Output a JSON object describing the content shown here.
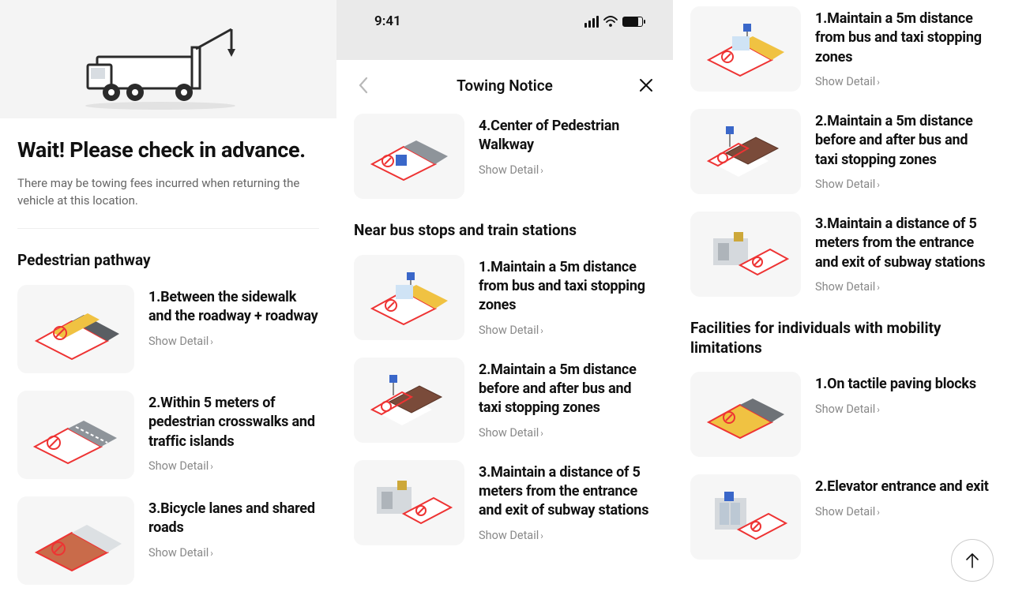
{
  "statusbar": {
    "time": "9:41"
  },
  "navbar": {
    "title": "Towing Notice"
  },
  "hero": {
    "title": "Wait! Please check in advance.",
    "subtitle": "There may be towing fees incurred when returning the vehicle at this location."
  },
  "show_detail_label": "Show Detail",
  "sections": {
    "pedestrian": {
      "title": "Pedestrian pathway",
      "items": [
        {
          "title": "1.Between the sidewalk and the roadway + roadway"
        },
        {
          "title": "2.Within 5 meters of pedestrian crosswalks and traffic islands"
        },
        {
          "title": "3.Bicycle lanes and shared roads"
        },
        {
          "title": "4.Center of Pedestrian Walkway"
        }
      ]
    },
    "bus": {
      "title": "Near bus stops and train stations",
      "items": [
        {
          "title": "1.Maintain a 5m distance from bus and taxi stopping zones"
        },
        {
          "title": "2.Maintain a 5m distance before and after bus and taxi stopping zones"
        },
        {
          "title": "3.Maintain a distance of 5 meters from the entrance and exit of subway stations"
        }
      ]
    },
    "mobility": {
      "title": "Facilities for individuals with mobility limitations",
      "items": [
        {
          "title": "1.On tactile paving blocks"
        },
        {
          "title": "2.Elevator entrance and exit"
        }
      ]
    }
  }
}
